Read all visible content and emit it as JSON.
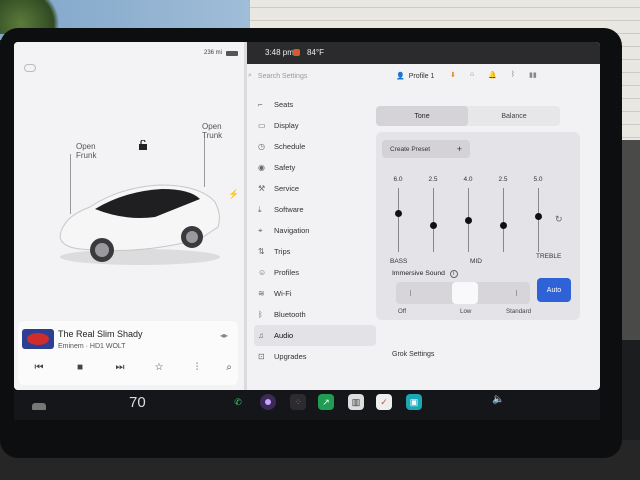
{
  "status": {
    "range": "236 mi",
    "time": "3:48 pm",
    "temperature": "84°F"
  },
  "car_view": {
    "frunk_label": "Open\nFrunk",
    "trunk_label": "Open\nTrunk"
  },
  "media": {
    "song": "The Real Slim Shady",
    "station": "Eminem · HD1 WOLT"
  },
  "settings": {
    "search_placeholder": "Search Settings",
    "profile": "Profile 1",
    "menu": [
      {
        "label": "Seats",
        "icon": "seat-icon"
      },
      {
        "label": "Display",
        "icon": "display-icon"
      },
      {
        "label": "Schedule",
        "icon": "clock-icon"
      },
      {
        "label": "Safety",
        "icon": "safety-icon"
      },
      {
        "label": "Service",
        "icon": "wrench-icon"
      },
      {
        "label": "Software",
        "icon": "download-icon"
      },
      {
        "label": "Navigation",
        "icon": "navigation-icon"
      },
      {
        "label": "Trips",
        "icon": "trips-icon"
      },
      {
        "label": "Profiles",
        "icon": "person-icon"
      },
      {
        "label": "Wi-Fi",
        "icon": "wifi-icon"
      },
      {
        "label": "Bluetooth",
        "icon": "bluetooth-icon"
      },
      {
        "label": "Audio",
        "icon": "audio-icon"
      },
      {
        "label": "Upgrades",
        "icon": "upgrades-icon"
      }
    ],
    "active_item": "Audio"
  },
  "audio": {
    "tabs": [
      "Tone",
      "Balance"
    ],
    "selected_tab": "Tone",
    "create_preset": "Create Preset",
    "preset_plus": "+",
    "eq": [
      {
        "value": "6.0",
        "level": 6.0
      },
      {
        "value": "2.5",
        "level": 2.5
      },
      {
        "value": "4.0",
        "level": 4.0
      },
      {
        "value": "2.5",
        "level": 2.5
      },
      {
        "value": "5.0",
        "level": 5.0
      }
    ],
    "eq_labels": {
      "bass": "BASS",
      "mid": "MID",
      "treble": "TREBLE"
    },
    "immersive_label": "Immersive Sound",
    "immersive_options": [
      "Off",
      "Low",
      "Standard"
    ],
    "immersive_selected": "Low",
    "auto_label": "Auto",
    "grok": "Grok Settings"
  },
  "taskbar": {
    "speed": "70"
  }
}
